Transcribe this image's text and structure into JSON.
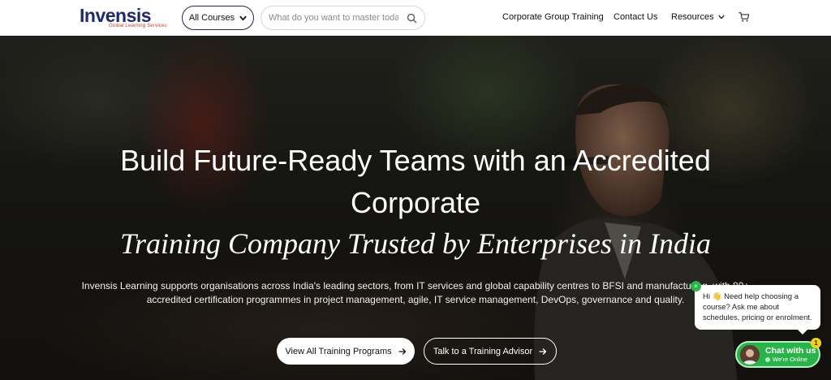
{
  "header": {
    "logo_text": "Invensis",
    "logo_tagline": "Global Learning Services",
    "courses_label": "All Courses",
    "search_placeholder": "What do you want to master today?",
    "nav": {
      "corporate": "Corporate Group Training",
      "contact": "Contact Us",
      "resources": "Resources"
    }
  },
  "hero": {
    "headline_line1": "Build Future-Ready Teams with an Accredited",
    "headline_line2": "Corporate",
    "headline_serif": "Training Company Trusted by Enterprises in India",
    "subtext": "Invensis Learning supports organisations across India's leading sectors, from IT services and global capability centres to BFSI and manufacturing, with 80+ accredited certification programmes in project management, agile, IT service management, DevOps, governance and quality.",
    "primary_button": "View All Training Programs",
    "secondary_button": "Talk to a Training Advisor"
  },
  "chat": {
    "message": "Hi 👋 Need help choosing a course? Ask me about schedules, pricing or enrolment.",
    "close_label": "×",
    "button_title": "Chat with us",
    "status": "We're Online",
    "badge_count": "1"
  },
  "colors": {
    "brand_navy": "#1f2a6b",
    "brand_red": "#c0392b",
    "chat_green": "#29b34a"
  }
}
